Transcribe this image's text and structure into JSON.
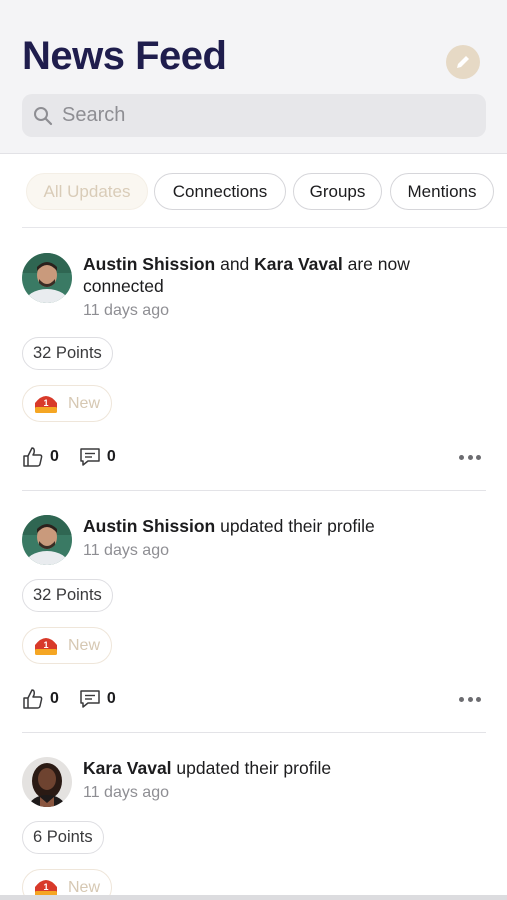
{
  "header": {
    "title": "News Feed",
    "compose_icon": "pencil-icon",
    "search_placeholder": "Search"
  },
  "tabs": [
    {
      "label": "All Updates",
      "active": true
    },
    {
      "label": "Connections",
      "active": false
    },
    {
      "label": "Groups",
      "active": false
    },
    {
      "label": "Mentions",
      "active": false
    }
  ],
  "posts": [
    {
      "actor": "Austin Shission",
      "middle": " and ",
      "actor2": "Kara Vaval",
      "action": " are now connected",
      "time": "11 days ago",
      "points": "32 Points",
      "badge": "New",
      "likes": "0",
      "comments": "0"
    },
    {
      "actor": "Austin Shission",
      "action": " updated their profile",
      "time": "11 days ago",
      "points": "32 Points",
      "badge": "New",
      "likes": "0",
      "comments": "0"
    },
    {
      "actor": "Kara Vaval",
      "action": " updated their profile",
      "time": "11 days ago",
      "points": "6 Points",
      "badge": "New"
    }
  ],
  "colors": {
    "title": "#1f1d4d",
    "accent_beige": "#e6d9c5",
    "badge_red": "#d83a2a"
  }
}
